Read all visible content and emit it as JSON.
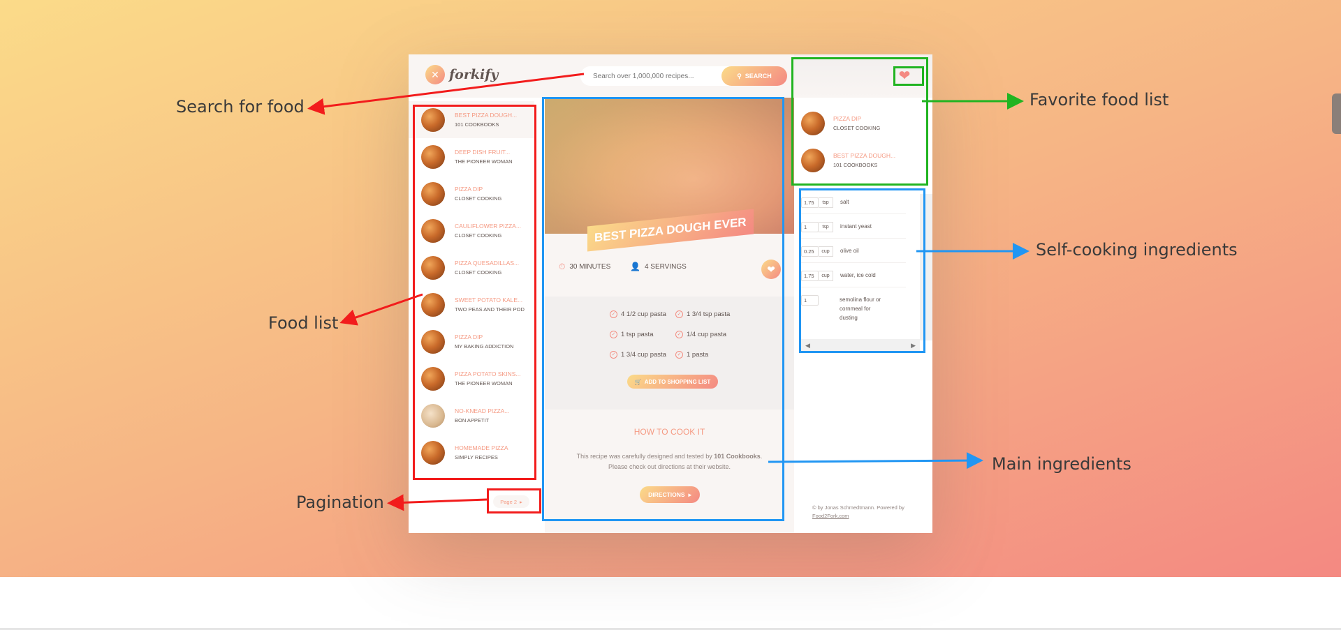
{
  "app": {
    "logo_text": "forkify",
    "logo_icon": "fork-knife-icon"
  },
  "search": {
    "placeholder": "Search over 1,000,000 recipes...",
    "button_label": "SEARCH"
  },
  "results": [
    {
      "title": "BEST PIZZA DOUGH...",
      "publisher": "101 COOKBOOKS",
      "active": true
    },
    {
      "title": "DEEP DISH FRUIT...",
      "publisher": "THE PIONEER WOMAN"
    },
    {
      "title": "PIZZA DIP",
      "publisher": "CLOSET COOKING"
    },
    {
      "title": "CAULIFLOWER PIZZA...",
      "publisher": "CLOSET COOKING"
    },
    {
      "title": "PIZZA QUESADILLAS...",
      "publisher": "CLOSET COOKING"
    },
    {
      "title": "SWEET POTATO KALE...",
      "publisher": "TWO PEAS AND THEIR POD"
    },
    {
      "title": "PIZZA DIP",
      "publisher": "MY BAKING ADDICTION"
    },
    {
      "title": "PIZZA POTATO SKINS...",
      "publisher": "THE PIONEER WOMAN"
    },
    {
      "title": "NO-KNEAD PIZZA...",
      "publisher": "BON APPETIT"
    },
    {
      "title": "HOMEMADE PIZZA",
      "publisher": "SIMPLY RECIPES"
    }
  ],
  "pagination": {
    "label": "Page 2"
  },
  "recipe": {
    "title": "BEST PIZZA DOUGH EVER",
    "time": "30 MINUTES",
    "servings": "4 SERVINGS",
    "ingredients": [
      "4 1/2 cup pasta",
      "1 3/4 tsp pasta",
      "1 tsp pasta",
      "1/4 cup pasta",
      "1 3/4 cup pasta",
      "1 pasta"
    ],
    "shopping_button": "ADD TO SHOPPING LIST",
    "how_to_heading": "HOW TO COOK IT",
    "directions_text_1": "This recipe was carefully designed and tested by ",
    "directions_publisher": "101 Cookbooks",
    "directions_text_2": ". Please check out directions at their website.",
    "directions_button": "DIRECTIONS"
  },
  "likes": [
    {
      "title": "PIZZA DIP",
      "publisher": "CLOSET COOKING"
    },
    {
      "title": "BEST PIZZA DOUGH...",
      "publisher": "101 COOKBOOKS"
    }
  ],
  "shopping_list": [
    {
      "qty": "1.75",
      "unit": "tsp",
      "desc": "salt"
    },
    {
      "qty": "1",
      "unit": "tsp",
      "desc": "instant yeast"
    },
    {
      "qty": "0.25",
      "unit": "cup",
      "desc": "olive oil"
    },
    {
      "qty": "1.75",
      "unit": "cup",
      "desc": "water, ice cold"
    },
    {
      "qty": "1",
      "unit": "",
      "desc": "semolina flour or cornmeal for dusting"
    }
  ],
  "footer": {
    "copyright": "© by Jonas Schmedtmann. Powered by",
    "link": "Food2Fork.com"
  },
  "annotations": {
    "search": "Search for food",
    "favorites": "Favorite food list",
    "self_cooking": "Self-cooking ingredients",
    "food_list": "Food list",
    "main_ingredients": "Main ingredients",
    "pagination": "Pagination"
  },
  "colors": {
    "red": "#f21c1c",
    "green": "#21b421",
    "blue": "#2196f3",
    "accent": "#f48982"
  }
}
